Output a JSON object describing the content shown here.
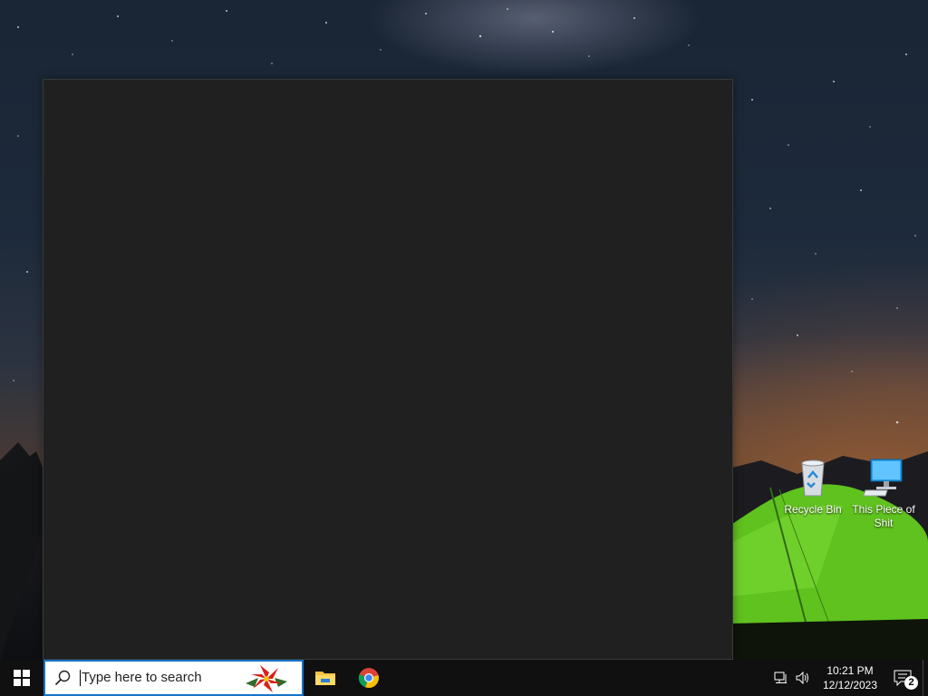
{
  "desktop": {
    "icons": [
      {
        "label": "Recycle Bin",
        "icon": "recycle-bin-icon"
      },
      {
        "label": "This Piece of Shit",
        "icon": "computer-icon"
      }
    ]
  },
  "window": {
    "theme": "dark",
    "background": "#202020"
  },
  "taskbar": {
    "start_icon": "windows-logo-icon",
    "search": {
      "placeholder": "Type here to search",
      "icon": "search-icon",
      "decoration": "poinsettia-icon"
    },
    "pinned_apps": [
      {
        "name": "File Explorer",
        "icon": "file-explorer-icon"
      },
      {
        "name": "Google Chrome",
        "icon": "chrome-icon"
      }
    ],
    "tray": {
      "icons": [
        "network-icon",
        "volume-icon"
      ],
      "time": "10:21 PM",
      "date": "12/12/2023",
      "notification_count": "2"
    }
  },
  "colors": {
    "taskbar": "#101010",
    "search_border": "#1673c9",
    "window": "#202020"
  }
}
